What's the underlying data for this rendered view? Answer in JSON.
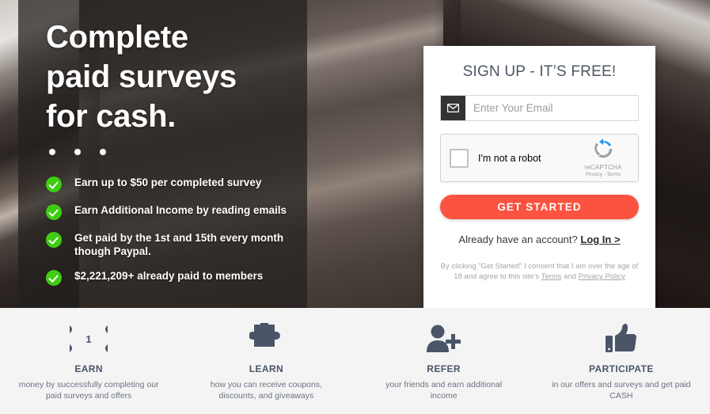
{
  "hero": {
    "title_lines": [
      "Complete",
      "paid surveys",
      "for cash."
    ],
    "bullets": [
      "Earn up to $50 per completed survey",
      "Earn Additional Income by reading emails",
      "Get paid by the 1st and 15th every month though Paypal.",
      "$2,221,209+ already paid to members"
    ]
  },
  "signup": {
    "title": "SIGN UP - IT’S FREE!",
    "email_placeholder": "Enter Your Email",
    "email_value": "",
    "email_icon": "envelope-icon",
    "recaptcha": {
      "label": "I'm not a robot",
      "brand": "reCAPTCHA",
      "links": "Privacy - Terms",
      "checked": false
    },
    "cta_label": "GET STARTED",
    "cta_color": "#fb5340",
    "login_prompt": "Already have an account?",
    "login_link": "Log In >",
    "disclaimer_pre": "By clicking \"Get Started\" I consent that I am over the age of 18 and agree to this site's ",
    "disclaimer_terms": "Terms",
    "disclaimer_mid": " and ",
    "disclaimer_privacy": "Privacy Policy"
  },
  "features": [
    {
      "icon": "banknote-icon",
      "title": "EARN",
      "desc": "money by successfully completing our paid surveys and offers"
    },
    {
      "icon": "puzzle-piece-icon",
      "title": "LEARN",
      "desc": "how you can receive coupons, discounts, and giveaways"
    },
    {
      "icon": "person-plus-icon",
      "title": "REFER",
      "desc": "your friends and earn additional income"
    },
    {
      "icon": "thumbs-up-icon",
      "title": "PARTICIPATE",
      "desc": "in our offers and surveys and get paid CASH"
    }
  ],
  "colors": {
    "accent": "#fb5340",
    "check_green": "#3fcc12",
    "slate": "#4a5568",
    "footer_bg": "#f4f4f5"
  }
}
